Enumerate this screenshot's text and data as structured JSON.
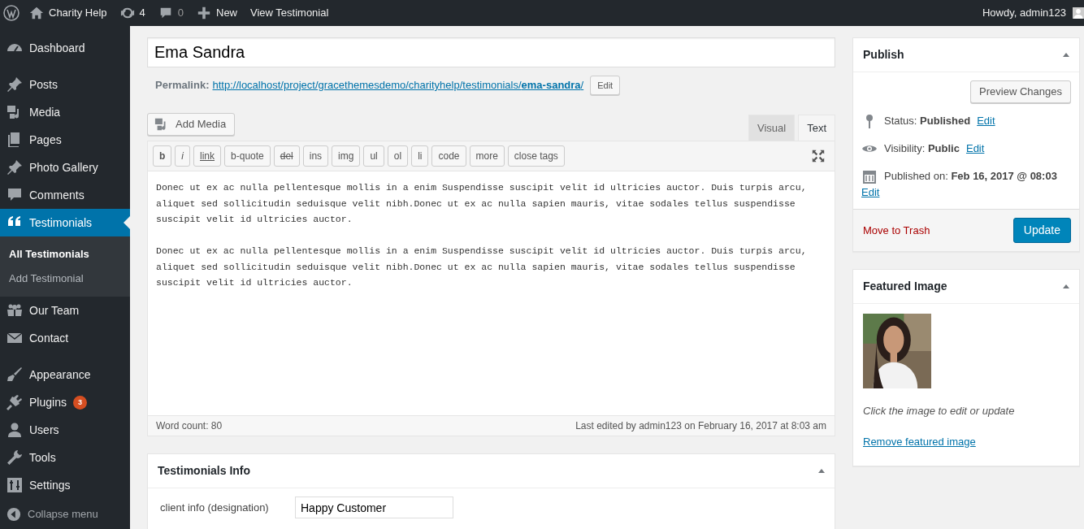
{
  "admin_bar": {
    "items": [
      {
        "kind": "logo"
      },
      {
        "kind": "site",
        "label": "Charity Help"
      },
      {
        "kind": "updates",
        "label": "4"
      },
      {
        "kind": "comments",
        "label": "0"
      },
      {
        "kind": "new",
        "label": "New"
      },
      {
        "kind": "link",
        "label": "View Testimonial"
      }
    ],
    "greeting": "Howdy, admin123"
  },
  "sidebar": {
    "groups": [
      [
        {
          "label": "Dashboard",
          "selected": false
        }
      ],
      [
        {
          "label": "Posts",
          "selected": false
        },
        {
          "label": "Media",
          "selected": false
        },
        {
          "label": "Pages",
          "selected": false
        },
        {
          "label": "Photo Gallery",
          "selected": false
        },
        {
          "label": "Comments",
          "selected": false
        },
        {
          "label": "Testimonials",
          "selected": true,
          "children": [
            {
              "label": "All Testimonials",
              "selected": true
            },
            {
              "label": "Add Testimonial",
              "selected": false
            }
          ]
        },
        {
          "label": "Our Team",
          "selected": false
        },
        {
          "label": "Contact",
          "selected": false
        }
      ],
      [
        {
          "label": "Appearance",
          "selected": false
        },
        {
          "label": "Plugins",
          "selected": false,
          "badge": "3"
        },
        {
          "label": "Users",
          "selected": false
        },
        {
          "label": "Tools",
          "selected": false
        },
        {
          "label": "Settings",
          "selected": false
        }
      ]
    ],
    "collapse": "Collapse menu"
  },
  "editor": {
    "title": "Ema Sandra",
    "permalink": {
      "label": "Permalink:",
      "url_base": "http://localhost/project/gracethemesdemo/charityhelp/testimonials/",
      "slug": "ema-sandra",
      "url_end": "/",
      "edit": "Edit"
    },
    "add_media": "Add Media",
    "tabs": [
      {
        "label": "Visual",
        "selected": false
      },
      {
        "label": "Text",
        "selected": true
      }
    ],
    "quicktags": [
      {
        "label": "b",
        "kind": "bold"
      },
      {
        "label": "i",
        "kind": "italic"
      },
      {
        "label": "link",
        "kind": "link"
      },
      {
        "label": "b-quote",
        "kind": "plain"
      },
      {
        "label": "del",
        "kind": "del"
      },
      {
        "label": "ins",
        "kind": "plain"
      },
      {
        "label": "img",
        "kind": "plain"
      },
      {
        "label": "ul",
        "kind": "plain"
      },
      {
        "label": "ol",
        "kind": "plain"
      },
      {
        "label": "li",
        "kind": "plain"
      },
      {
        "label": "code",
        "kind": "plain"
      },
      {
        "label": "more",
        "kind": "plain"
      },
      {
        "label": "close tags",
        "kind": "plain"
      }
    ],
    "content": [
      "Donec ut ex ac nulla pellentesque mollis in a enim Suspendisse suscipit velit id ultricies auctor. Duis turpis arcu, aliquet sed sollicitudin seduisque velit nibh.Donec ut ex ac nulla sapien mauris, vitae sodales tellus suspendisse suscipit velit id ultricies auctor.",
      "Donec ut ex ac nulla pellentesque mollis in a enim Suspendisse suscipit velit id ultricies auctor. Duis turpis arcu, aliquet sed sollicitudin seduisque velit nibh.Donec ut ex ac nulla sapien mauris, vitae sodales tellus suspendisse suscipit velit id ultricies auctor."
    ],
    "word_count": "Word count: 80",
    "last_edited": "Last edited by admin123 on February 16, 2017 at 8:03 am"
  },
  "info_box": {
    "title": "Testimonials Info",
    "expanded": true,
    "fields": [
      {
        "label": "client info (designation)",
        "value": "Happy Customer"
      }
    ]
  },
  "publish": {
    "title": "Publish",
    "expanded": true,
    "preview": "Preview Changes",
    "rows": [
      {
        "kind": "status",
        "label": "Status:",
        "value": "Published",
        "link": "Edit"
      },
      {
        "kind": "visibility",
        "label": "Visibility:",
        "value": "Public",
        "link": "Edit"
      },
      {
        "kind": "date",
        "label": "Published on:",
        "value": "Feb 16, 2017 @ 08:03",
        "link": "Edit"
      }
    ],
    "trash": "Move to Trash",
    "update": "Update"
  },
  "featured": {
    "title": "Featured Image",
    "expanded": true,
    "caption": "Click the image to edit or update",
    "remove": "Remove featured image"
  }
}
